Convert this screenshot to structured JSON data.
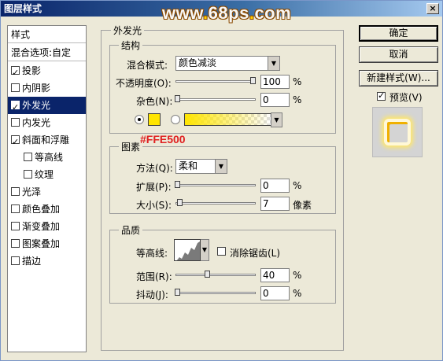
{
  "window": {
    "title": "图层样式",
    "close_glyph": "×"
  },
  "watermark": {
    "prefix": "www",
    "dot1": ".",
    "site": "68ps",
    "dot2": ".",
    "tld": "com"
  },
  "sidebar": {
    "header": "样式",
    "blend_options": "混合选项:自定",
    "items": [
      {
        "label": "投影",
        "checked": true
      },
      {
        "label": "内阴影",
        "checked": false
      },
      {
        "label": "外发光",
        "checked": true,
        "selected": true
      },
      {
        "label": "内发光",
        "checked": false
      },
      {
        "label": "斜面和浮雕",
        "checked": true
      },
      {
        "label": "等高线",
        "checked": false,
        "indent": true
      },
      {
        "label": "纹理",
        "checked": false,
        "indent": true
      },
      {
        "label": "光泽",
        "checked": false
      },
      {
        "label": "颜色叠加",
        "checked": false
      },
      {
        "label": "渐变叠加",
        "checked": false
      },
      {
        "label": "图案叠加",
        "checked": false
      },
      {
        "label": "描边",
        "checked": false
      }
    ]
  },
  "panel": {
    "title": "外发光",
    "structure": {
      "title": "结构",
      "blend_mode_label": "混合模式:",
      "blend_mode_value": "颜色减淡",
      "opacity_label": "不透明度(O):",
      "opacity_value": "100",
      "opacity_unit": "%",
      "opacity_level": 1.0,
      "noise_label": "杂色(N):",
      "noise_value": "0",
      "noise_unit": "%",
      "noise_level": 0.0,
      "glow_color": "#ffe500"
    },
    "elements": {
      "title": "图素",
      "annotation": "#FFE500",
      "technique_label": "方法(Q):",
      "technique_value": "柔和",
      "spread_label": "扩展(P):",
      "spread_value": "0",
      "spread_unit": "%",
      "spread_level": 0.0,
      "size_label": "大小(S):",
      "size_value": "7",
      "size_unit": "像素",
      "size_level": 0.03
    },
    "quality": {
      "title": "品质",
      "contour_label": "等高线:",
      "antialias_label": "消除锯齿(L)",
      "antialias_checked": false,
      "range_label": "范围(R):",
      "range_value": "40",
      "range_unit": "%",
      "range_level": 0.4,
      "jitter_label": "抖动(J):",
      "jitter_value": "0",
      "jitter_unit": "%",
      "jitter_level": 0.0
    }
  },
  "buttons": {
    "ok": "确定",
    "cancel": "取消",
    "new_style": "新建样式(W)...",
    "preview_label": "预览(V)",
    "preview_checked": true
  }
}
